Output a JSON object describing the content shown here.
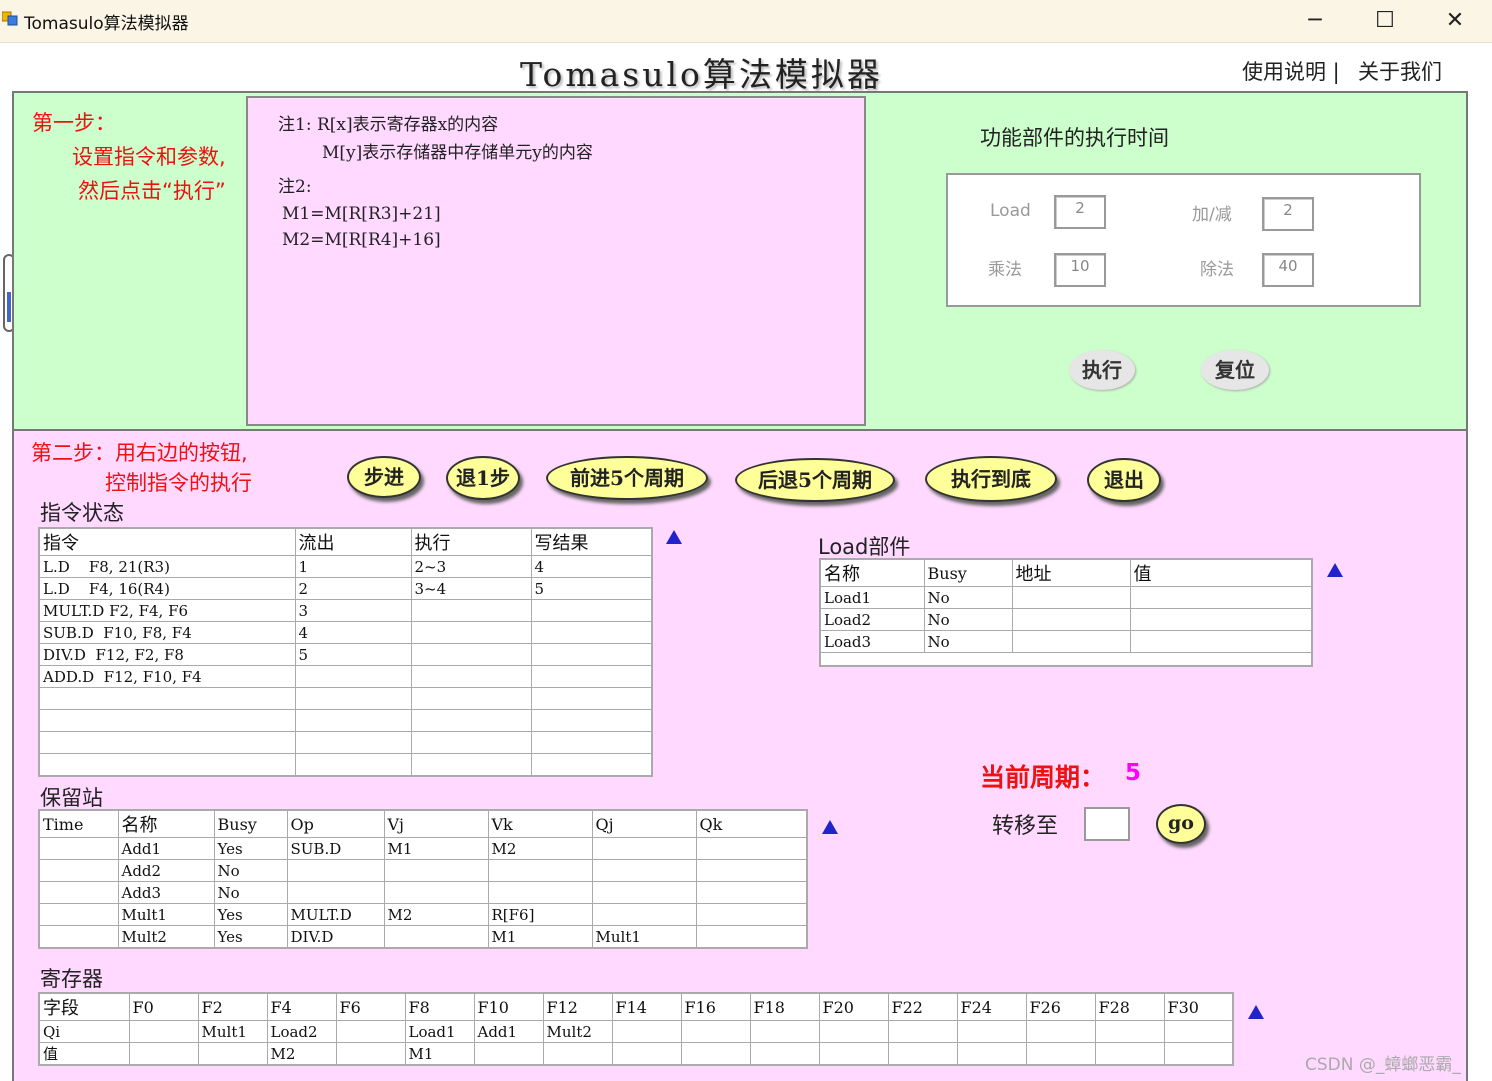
{
  "window": {
    "title": "Tomasulo算法模拟器",
    "minimize": "─",
    "maximize": "☐",
    "close": "✕"
  },
  "header": {
    "title": "Tomasulo算法模拟器",
    "help": "使用说明 |",
    "about": "关于我们"
  },
  "step1": {
    "heading": "第一步：",
    "line1": "设置指令和参数,",
    "line2": "然后点击“执行”",
    "notes": {
      "n1a": "注1: R[x]表示寄存器x的内容",
      "n1b": "M[y]表示存储器中存储单元y的内容",
      "n2": "注2:",
      "m1": "M1=M[R[R3]+21]",
      "m2": "M2=M[R[R4]+16]"
    },
    "fu_title": "功能部件的执行时间",
    "fu": {
      "load_label": "Load",
      "load_value": "2",
      "add_label": "加/减",
      "add_value": "2",
      "mul_label": "乘法",
      "mul_value": "10",
      "div_label": "除法",
      "div_value": "40"
    },
    "execute_label": "执行",
    "reset_label": "复位"
  },
  "step2": {
    "heading": "第二步：用右边的按钮,",
    "line2": "控制指令的执行",
    "buttons": {
      "step": "步进",
      "back1": "退1步",
      "fwd5": "前进5个周期",
      "back5": "后退5个周期",
      "run": "执行到底",
      "exit": "退出"
    }
  },
  "instr_status": {
    "title": "指令状态",
    "headers": [
      "指令",
      "流出",
      "执行",
      "写结果"
    ],
    "rows": [
      [
        "L.D    F8, 21(R3)",
        "1",
        "2~3",
        "4"
      ],
      [
        "L.D    F4, 16(R4)",
        "2",
        "3~4",
        "5"
      ],
      [
        "MULT.D F2, F4, F6",
        "3",
        "",
        ""
      ],
      [
        "SUB.D  F10, F8, F4",
        "4",
        "",
        ""
      ],
      [
        "DIV.D  F12, F2, F8",
        "5",
        "",
        ""
      ],
      [
        "ADD.D  F12, F10, F4",
        "",
        "",
        ""
      ],
      [
        "",
        "",
        "",
        ""
      ],
      [
        "",
        "",
        "",
        ""
      ],
      [
        "",
        "",
        "",
        ""
      ],
      [
        "",
        "",
        "",
        ""
      ]
    ]
  },
  "load_unit": {
    "title": "Load部件",
    "headers": [
      "名称",
      "Busy",
      "地址",
      "值"
    ],
    "rows": [
      [
        "Load1",
        "No",
        "",
        ""
      ],
      [
        "Load2",
        "No",
        "",
        ""
      ],
      [
        "Load3",
        "No",
        "",
        ""
      ]
    ]
  },
  "cycle": {
    "label": "当前周期：",
    "value": "5",
    "goto_label": "转移至",
    "goto_value": "",
    "go_button": "go"
  },
  "reservation": {
    "title": "保留站",
    "headers": [
      "Time",
      "名称",
      "Busy",
      "Op",
      "Vj",
      "Vk",
      "Qj",
      "Qk"
    ],
    "rows": [
      [
        "",
        "Add1",
        "Yes",
        "SUB.D",
        "M1",
        "M2",
        "",
        ""
      ],
      [
        "",
        "Add2",
        "No",
        "",
        "",
        "",
        "",
        ""
      ],
      [
        "",
        "Add3",
        "No",
        "",
        "",
        "",
        "",
        ""
      ],
      [
        "",
        "Mult1",
        "Yes",
        "MULT.D",
        "M2",
        "R[F6]",
        "",
        ""
      ],
      [
        "",
        "Mult2",
        "Yes",
        "DIV.D",
        "",
        "M1",
        "Mult1",
        ""
      ]
    ]
  },
  "registers": {
    "title": "寄存器",
    "headers": [
      "字段",
      "F0",
      "F2",
      "F4",
      "F6",
      "F8",
      "F10",
      "F12",
      "F14",
      "F16",
      "F18",
      "F20",
      "F22",
      "F24",
      "F26",
      "F28",
      "F30"
    ],
    "rows": [
      [
        "Qi",
        "",
        "Mult1",
        "Load2",
        "",
        "Load1",
        "Add1",
        "Mult2",
        "",
        "",
        "",
        "",
        "",
        "",
        "",
        "",
        ""
      ],
      [
        "值",
        "",
        "",
        "M2",
        "",
        "M1",
        "",
        "",
        "",
        "",
        "",
        "",
        "",
        "",
        "",
        "",
        ""
      ]
    ]
  },
  "watermark": "CSDN @_蟑螂恶霸_",
  "colors": {
    "step1_bg": "#ccffcc",
    "step2_bg": "#ffd9ff",
    "button_bg": "#ffff99",
    "accent_red": "#ee1111",
    "cycle_magenta": "#ff00ff"
  }
}
